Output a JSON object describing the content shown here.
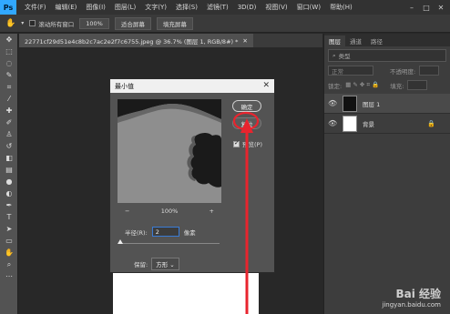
{
  "menubar": {
    "logo": "Ps",
    "items": [
      "文件(F)",
      "编辑(E)",
      "图像(I)",
      "图层(L)",
      "文字(Y)",
      "选择(S)",
      "滤镜(T)",
      "3D(D)",
      "视图(V)",
      "窗口(W)",
      "帮助(H)"
    ]
  },
  "options": {
    "scroll_all": "滚动所有窗口",
    "zoom": "100%",
    "fit_screen": "适合屏幕",
    "fill_screen": "填充屏幕"
  },
  "document": {
    "tab_title": "22771cf29d51e4c8b2c7ac2e2f7c6755.jpeg @ 36.7% (图层 1, RGB/8#) *"
  },
  "dialog": {
    "title": "最小值",
    "ok": "确定",
    "reset": "复位",
    "preview_label": "预览(P)",
    "zoom_out": "−",
    "zoom_level": "100%",
    "zoom_in": "+",
    "radius_label": "半径(R):",
    "radius_value": "2",
    "radius_unit": "像素",
    "radius_slider_fraction": 0.0,
    "keep_label": "保留:",
    "keep_value": "方形"
  },
  "panel": {
    "tabs": [
      "图层",
      "通道",
      "路径"
    ],
    "filter_label": "类型",
    "blend_mode": "正常",
    "opacity_label": "不透明度:",
    "lock_label": "锁定:",
    "fill_label": "填充:",
    "layers": [
      {
        "name": "图层 1",
        "selected": true
      },
      {
        "name": "背景",
        "selected": false,
        "locked": true
      }
    ]
  },
  "watermark": {
    "main": "Bai 经验",
    "sub": "jingyan.baidu.com"
  },
  "colors": {
    "annotation_arrow": "#e8242e",
    "ps_blue": "#31a8ff"
  }
}
